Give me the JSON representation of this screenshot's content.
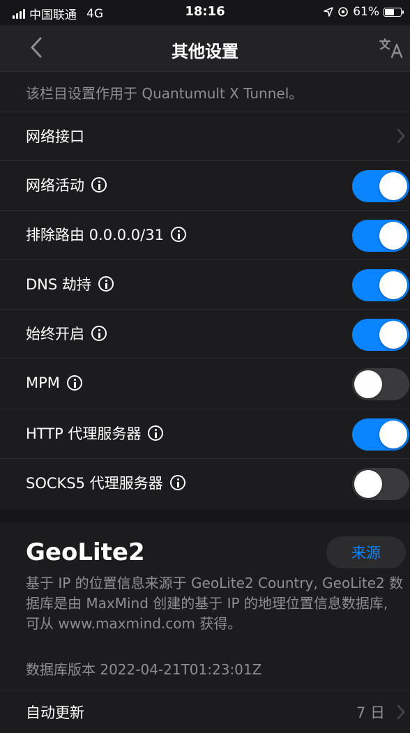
{
  "status_bar": {
    "carrier": "中国联通",
    "network": "4G",
    "time": "18:16",
    "battery": "61%",
    "battery_level": 0.61
  },
  "nav": {
    "title": "其他设置",
    "back_icon": "chevron-left-icon",
    "translate_icon": "translate-icon"
  },
  "note": "该栏目设置作用于 Quantumult X Tunnel。",
  "network_interface": {
    "label": "网络接口"
  },
  "settings": [
    {
      "label": "网络活动",
      "enabled": true
    },
    {
      "label": "排除路由 0.0.0.0/31",
      "enabled": true
    },
    {
      "label": "DNS 劫持",
      "enabled": true
    },
    {
      "label": "始终开启",
      "enabled": true
    },
    {
      "label": "MPM",
      "enabled": false
    },
    {
      "label": "HTTP 代理服务器",
      "enabled": true
    },
    {
      "label": "SOCKS5 代理服务器",
      "enabled": false
    }
  ],
  "geolite": {
    "title": "GeoLite2",
    "source_button": "来源",
    "description": "基于 IP 的位置信息来源于 GeoLite2 Country, GeoLite2 数据库是由 MaxMind 创建的基于 IP 的地理位置信息数据库, 可从 www.maxmind.com 获得。",
    "version": "数据库版本 2022-04-21T01:23:01Z"
  },
  "auto_update": {
    "label": "自动更新",
    "value": "7 日"
  },
  "colors": {
    "accent": "#0a84ff",
    "background": "#1c1c1e",
    "secondary_text": "#8e8e93"
  }
}
